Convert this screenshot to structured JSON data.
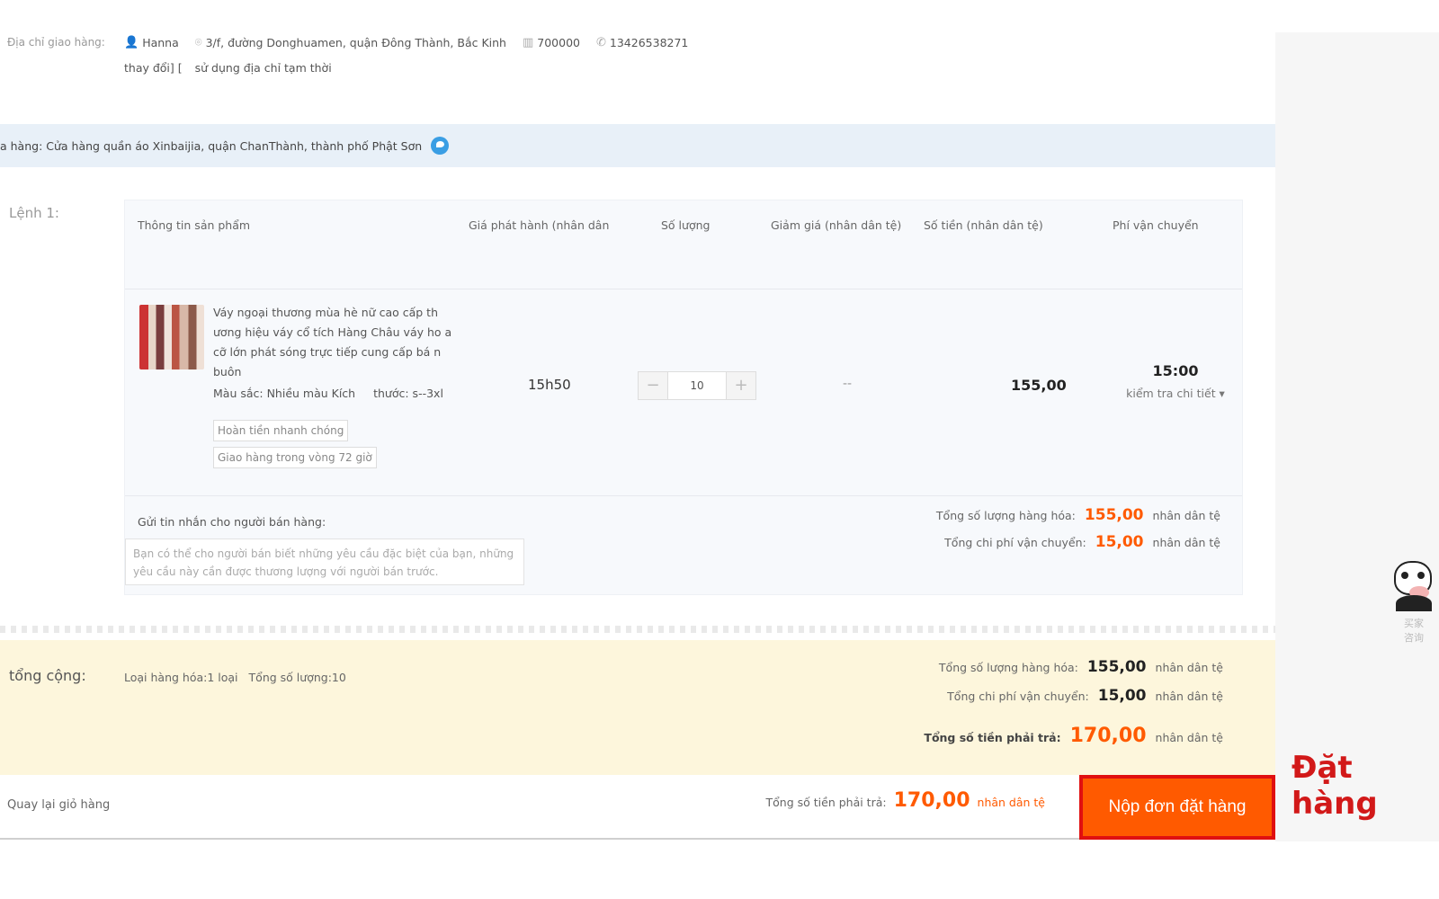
{
  "address": {
    "label": "Địa chỉ giao hàng:",
    "name": "Hanna",
    "street": "3/f, đường Donghuamen, quận Đông Thành, Bắc Kinh",
    "postcode": "700000",
    "phone": "13426538271",
    "change_link": "thay đổi] [",
    "temp_link": "sử dụng địa chỉ tạm thời"
  },
  "store": {
    "label": "a hàng: Cửa hàng quần áo Xinbaijia, quận ChanThành, thành phố Phật Sơn"
  },
  "order": {
    "label": "Lệnh 1:",
    "headers": {
      "product": "Thông tin sản phẩm",
      "price": "Giá phát hành (nhân dân",
      "qty": "Số lượng",
      "discount": "Giảm giá (nhân dân tệ)",
      "amount": "Số tiền (nhân dân tệ)",
      "shipping": "Phí vận chuyển"
    },
    "item": {
      "name": "Váy ngoại thương mùa hè nữ cao cấp th ương hiệu váy cổ tích Hàng Châu váy ho a cỡ lớn phát sóng trực tiếp cung cấp bá n buôn",
      "attr_color": "Màu sắc: Nhiều màu Kích",
      "attr_size": "thước: s--3xl",
      "tag_refund": "Hoàn tiền nhanh chóng",
      "tag_delivery": "Giao hàng trong vòng 72 giờ",
      "price": "15h50",
      "qty": "10",
      "qty_minus": "−",
      "qty_plus": "+",
      "discount": "--",
      "amount": "155,00",
      "shipping_time": "15:00",
      "shipping_detail": "kiểm tra chi tiết ▾"
    },
    "message_label": "Gửi tin nhắn cho người bán hàng:",
    "message_placeholder": "Bạn có thể cho người bán biết những yêu cầu đặc biệt của bạn, những yêu cầu này cần được thương lượng với người bán trước.",
    "goods_total_label": "Tổng số lượng hàng hóa:",
    "goods_total": "155,00",
    "ship_total_label": "Tổng chi phí vận chuyển:",
    "ship_total": "15,00",
    "currency": "nhân dân tệ"
  },
  "total": {
    "label": "tổng cộng:",
    "item_types": "Loại hàng hóa:1 loại",
    "item_count": "Tổng số lượng:10",
    "goods_total_label": "Tổng số lượng hàng hóa:",
    "goods_total": "155,00",
    "ship_total_label": "Tổng chi phí vận chuyển:",
    "ship_total": "15,00",
    "grand_label": "Tổng số tiền phải trả:",
    "grand_total": "170,00",
    "currency": "nhân dân tệ"
  },
  "footer": {
    "back": "Quay lại giỏ hàng",
    "grand_label": "Tổng số tiền phải trả:",
    "grand_total": "170,00",
    "currency": "nhân dân tệ",
    "submit": "Nộp đơn đặt hàng"
  },
  "annotation": "Đặt hàng",
  "mascot_text": "买家\n咨询",
  "colors": {
    "accent": "#ff5a00",
    "highlight_border": "#e01010",
    "store_bar": "#e8f0f8",
    "total_bg": "#fdf6dc"
  }
}
